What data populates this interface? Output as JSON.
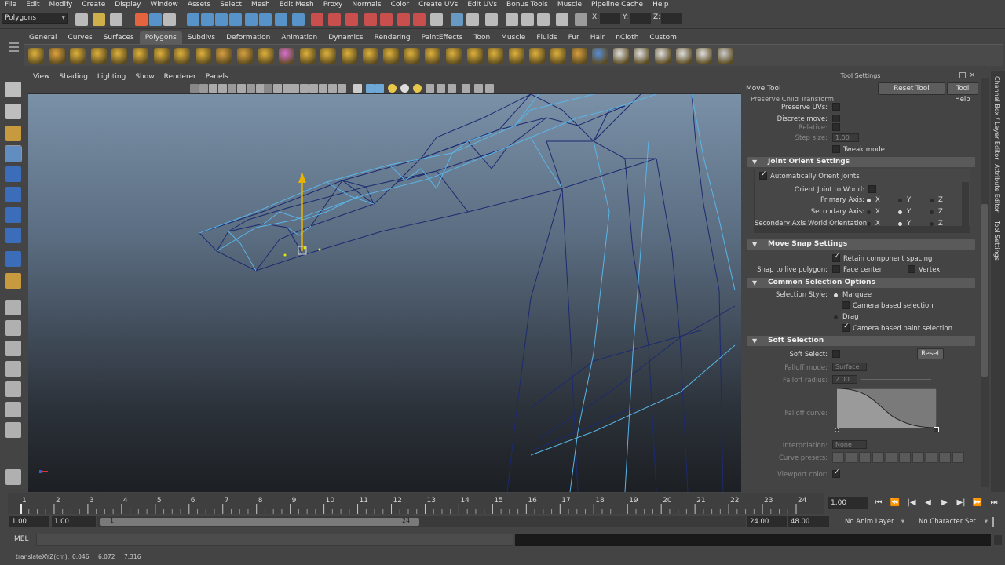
{
  "menubar": [
    "File",
    "Edit",
    "Modify",
    "Create",
    "Display",
    "Window",
    "Assets",
    "Select",
    "Mesh",
    "Edit Mesh",
    "Proxy",
    "Normals",
    "Color",
    "Create UVs",
    "Edit UVs",
    "Bonus Tools",
    "Muscle",
    "Pipeline Cache",
    "Help"
  ],
  "menu_set": "Polygons",
  "status": {
    "x_label": "X:",
    "y_label": "Y:",
    "z_label": "Z:"
  },
  "shelf_tabs": [
    "General",
    "Curves",
    "Surfaces",
    "Polygons",
    "Subdivs",
    "Deformation",
    "Animation",
    "Dynamics",
    "Rendering",
    "PaintEffects",
    "Toon",
    "Muscle",
    "Fluids",
    "Fur",
    "Hair",
    "nCloth",
    "Custom"
  ],
  "shelf_active": "Polygons",
  "viewport_menu": [
    "View",
    "Shading",
    "Lighting",
    "Show",
    "Renderer",
    "Panels"
  ],
  "viewport_axis": {
    "x": "x",
    "y": "y"
  },
  "tool_settings": {
    "panel_title": "Tool Settings",
    "tool_name": "Move Tool",
    "reset_tool": "Reset Tool",
    "tool_help": "Tool Help",
    "preserve_child": "Preserve Child Transform",
    "preserve_uvs": "Preserve UVs:",
    "discrete_move": "Discrete move:",
    "relative": "Relative:",
    "step_size": "Step size:",
    "step_size_value": "1.00",
    "tweak_mode": "Tweak mode",
    "joint_orient": {
      "title": "Joint Orient Settings",
      "auto_orient": "Automatically Orient Joints",
      "orient_world": "Orient Joint to World:",
      "primary_axis": "Primary Axis:",
      "secondary_axis": "Secondary Axis:",
      "secondary_world": "Secondary Axis World Orientation:",
      "axes": [
        "X",
        "Y",
        "Z"
      ]
    },
    "move_snap": {
      "title": "Move Snap Settings",
      "retain": "Retain component spacing",
      "snap_live": "Snap to live polygon:",
      "face_center": "Face center",
      "vertex": "Vertex"
    },
    "common_selection": {
      "title": "Common Selection Options",
      "selection_style": "Selection Style:",
      "marquee": "Marquee",
      "camera_based": "Camera based selection",
      "drag": "Drag",
      "camera_paint": "Camera based paint selection"
    },
    "soft_selection": {
      "title": "Soft Selection",
      "soft_select": "Soft Select:",
      "reset": "Reset",
      "falloff_mode": "Falloff mode:",
      "falloff_mode_value": "Surface",
      "falloff_radius": "Falloff radius:",
      "falloff_radius_value": "2.00",
      "falloff_curve": "Falloff curve:",
      "interpolation": "Interpolation:",
      "interpolation_value": "None",
      "curve_presets": "Curve presets:",
      "viewport_color": "Viewport color:"
    }
  },
  "side_tabs": [
    "Channel Box / Layer Editor",
    "Attribute Editor",
    "Tool Settings"
  ],
  "timeline": {
    "ticks": [
      "1",
      "2",
      "3",
      "4",
      "5",
      "6",
      "7",
      "8",
      "9",
      "10",
      "11",
      "12",
      "13",
      "14",
      "15",
      "16",
      "17",
      "18",
      "19",
      "20",
      "21",
      "22",
      "23",
      "24"
    ],
    "current": "1.00"
  },
  "range": {
    "start": "1.00",
    "start2": "1.00",
    "slider_start": "1",
    "slider_end": "24",
    "end": "24.00",
    "end2": "48.00",
    "anim_layer": "No Anim Layer",
    "char_set": "No Character Set"
  },
  "mel_label": "MEL",
  "help_line": {
    "label": "translateXYZ(cm):",
    "x": "0.046",
    "y": "6.072",
    "z": "7.316"
  }
}
